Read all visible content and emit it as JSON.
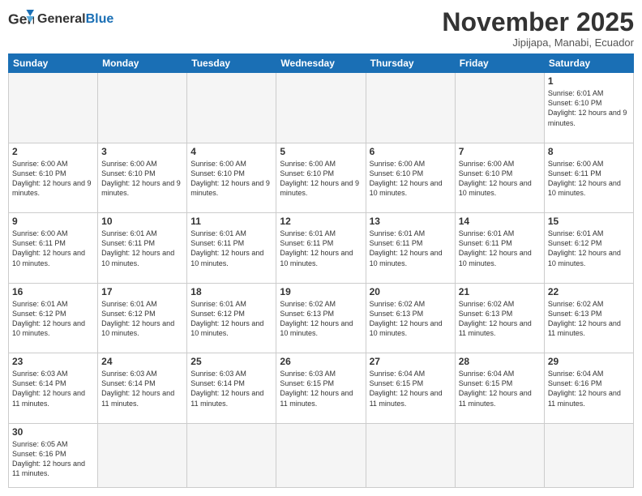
{
  "logo": {
    "text_general": "General",
    "text_blue": "Blue"
  },
  "header": {
    "month_title": "November 2025",
    "subtitle": "Jipijapa, Manabi, Ecuador"
  },
  "weekdays": [
    "Sunday",
    "Monday",
    "Tuesday",
    "Wednesday",
    "Thursday",
    "Friday",
    "Saturday"
  ],
  "weeks": [
    [
      {
        "day": "",
        "info": "",
        "empty": true
      },
      {
        "day": "",
        "info": "",
        "empty": true
      },
      {
        "day": "",
        "info": "",
        "empty": true
      },
      {
        "day": "",
        "info": "",
        "empty": true
      },
      {
        "day": "",
        "info": "",
        "empty": true
      },
      {
        "day": "",
        "info": "",
        "empty": true
      },
      {
        "day": "1",
        "info": "Sunrise: 6:01 AM\nSunset: 6:10 PM\nDaylight: 12 hours and 9 minutes.",
        "empty": false
      }
    ],
    [
      {
        "day": "2",
        "info": "Sunrise: 6:00 AM\nSunset: 6:10 PM\nDaylight: 12 hours and 9 minutes.",
        "empty": false
      },
      {
        "day": "3",
        "info": "Sunrise: 6:00 AM\nSunset: 6:10 PM\nDaylight: 12 hours and 9 minutes.",
        "empty": false
      },
      {
        "day": "4",
        "info": "Sunrise: 6:00 AM\nSunset: 6:10 PM\nDaylight: 12 hours and 9 minutes.",
        "empty": false
      },
      {
        "day": "5",
        "info": "Sunrise: 6:00 AM\nSunset: 6:10 PM\nDaylight: 12 hours and 9 minutes.",
        "empty": false
      },
      {
        "day": "6",
        "info": "Sunrise: 6:00 AM\nSunset: 6:10 PM\nDaylight: 12 hours and 10 minutes.",
        "empty": false
      },
      {
        "day": "7",
        "info": "Sunrise: 6:00 AM\nSunset: 6:10 PM\nDaylight: 12 hours and 10 minutes.",
        "empty": false
      },
      {
        "day": "8",
        "info": "Sunrise: 6:00 AM\nSunset: 6:11 PM\nDaylight: 12 hours and 10 minutes.",
        "empty": false
      }
    ],
    [
      {
        "day": "9",
        "info": "Sunrise: 6:00 AM\nSunset: 6:11 PM\nDaylight: 12 hours and 10 minutes.",
        "empty": false
      },
      {
        "day": "10",
        "info": "Sunrise: 6:01 AM\nSunset: 6:11 PM\nDaylight: 12 hours and 10 minutes.",
        "empty": false
      },
      {
        "day": "11",
        "info": "Sunrise: 6:01 AM\nSunset: 6:11 PM\nDaylight: 12 hours and 10 minutes.",
        "empty": false
      },
      {
        "day": "12",
        "info": "Sunrise: 6:01 AM\nSunset: 6:11 PM\nDaylight: 12 hours and 10 minutes.",
        "empty": false
      },
      {
        "day": "13",
        "info": "Sunrise: 6:01 AM\nSunset: 6:11 PM\nDaylight: 12 hours and 10 minutes.",
        "empty": false
      },
      {
        "day": "14",
        "info": "Sunrise: 6:01 AM\nSunset: 6:11 PM\nDaylight: 12 hours and 10 minutes.",
        "empty": false
      },
      {
        "day": "15",
        "info": "Sunrise: 6:01 AM\nSunset: 6:12 PM\nDaylight: 12 hours and 10 minutes.",
        "empty": false
      }
    ],
    [
      {
        "day": "16",
        "info": "Sunrise: 6:01 AM\nSunset: 6:12 PM\nDaylight: 12 hours and 10 minutes.",
        "empty": false
      },
      {
        "day": "17",
        "info": "Sunrise: 6:01 AM\nSunset: 6:12 PM\nDaylight: 12 hours and 10 minutes.",
        "empty": false
      },
      {
        "day": "18",
        "info": "Sunrise: 6:01 AM\nSunset: 6:12 PM\nDaylight: 12 hours and 10 minutes.",
        "empty": false
      },
      {
        "day": "19",
        "info": "Sunrise: 6:02 AM\nSunset: 6:13 PM\nDaylight: 12 hours and 10 minutes.",
        "empty": false
      },
      {
        "day": "20",
        "info": "Sunrise: 6:02 AM\nSunset: 6:13 PM\nDaylight: 12 hours and 10 minutes.",
        "empty": false
      },
      {
        "day": "21",
        "info": "Sunrise: 6:02 AM\nSunset: 6:13 PM\nDaylight: 12 hours and 11 minutes.",
        "empty": false
      },
      {
        "day": "22",
        "info": "Sunrise: 6:02 AM\nSunset: 6:13 PM\nDaylight: 12 hours and 11 minutes.",
        "empty": false
      }
    ],
    [
      {
        "day": "23",
        "info": "Sunrise: 6:03 AM\nSunset: 6:14 PM\nDaylight: 12 hours and 11 minutes.",
        "empty": false
      },
      {
        "day": "24",
        "info": "Sunrise: 6:03 AM\nSunset: 6:14 PM\nDaylight: 12 hours and 11 minutes.",
        "empty": false
      },
      {
        "day": "25",
        "info": "Sunrise: 6:03 AM\nSunset: 6:14 PM\nDaylight: 12 hours and 11 minutes.",
        "empty": false
      },
      {
        "day": "26",
        "info": "Sunrise: 6:03 AM\nSunset: 6:15 PM\nDaylight: 12 hours and 11 minutes.",
        "empty": false
      },
      {
        "day": "27",
        "info": "Sunrise: 6:04 AM\nSunset: 6:15 PM\nDaylight: 12 hours and 11 minutes.",
        "empty": false
      },
      {
        "day": "28",
        "info": "Sunrise: 6:04 AM\nSunset: 6:15 PM\nDaylight: 12 hours and 11 minutes.",
        "empty": false
      },
      {
        "day": "29",
        "info": "Sunrise: 6:04 AM\nSunset: 6:16 PM\nDaylight: 12 hours and 11 minutes.",
        "empty": false
      }
    ],
    [
      {
        "day": "30",
        "info": "Sunrise: 6:05 AM\nSunset: 6:16 PM\nDaylight: 12 hours and 11 minutes.",
        "empty": false
      },
      {
        "day": "",
        "info": "",
        "empty": true
      },
      {
        "day": "",
        "info": "",
        "empty": true
      },
      {
        "day": "",
        "info": "",
        "empty": true
      },
      {
        "day": "",
        "info": "",
        "empty": true
      },
      {
        "day": "",
        "info": "",
        "empty": true
      },
      {
        "day": "",
        "info": "",
        "empty": true
      }
    ]
  ]
}
